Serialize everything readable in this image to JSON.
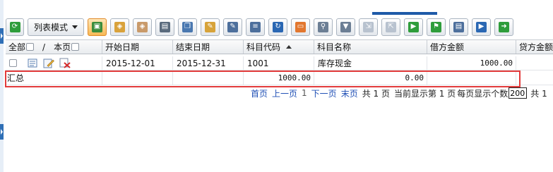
{
  "toolbar": {
    "view_mode_label": "列表模式",
    "buttons": [
      {
        "icon": "refresh-green-icon",
        "color": "#2e9d3b",
        "glyph": "⟳"
      },
      {
        "icon": "add-record-icon",
        "color": "#3c8d3c",
        "glyph": "▣",
        "active": true
      },
      {
        "icon": "archive-icon",
        "color": "#d9a23b",
        "glyph": "◈"
      },
      {
        "icon": "package-icon",
        "color": "#c99a6a",
        "glyph": "◈"
      },
      {
        "icon": "print-icon",
        "color": "#5a6b7d",
        "glyph": "▤"
      },
      {
        "icon": "copy-icon",
        "color": "#4a78b0",
        "glyph": "❐"
      },
      {
        "icon": "edit-icon",
        "color": "#d7a33a",
        "glyph": "✎"
      },
      {
        "icon": "document-edit-icon",
        "color": "#4d6f9c",
        "glyph": "✎"
      },
      {
        "icon": "document-list-icon",
        "color": "#4d6f9c",
        "glyph": "≡"
      },
      {
        "icon": "reload-icon",
        "color": "#2a67b3",
        "glyph": "↻"
      },
      {
        "icon": "window-icon",
        "color": "#e2772f",
        "glyph": "▭"
      },
      {
        "icon": "filter-clear-icon",
        "color": "#6c7f95",
        "glyph": "⚲"
      },
      {
        "icon": "filter-icon",
        "color": "#6c7f95",
        "glyph": "▼"
      },
      {
        "icon": "import-icon",
        "color": "#b8c2cf",
        "glyph": "⇲"
      },
      {
        "icon": "export-icon",
        "color": "#b8c2cf",
        "glyph": "⇱"
      },
      {
        "icon": "play-icon",
        "color": "#2e9d3b",
        "glyph": "▶"
      },
      {
        "icon": "bookmark-icon",
        "color": "#2e9d3b",
        "glyph": "⚑"
      },
      {
        "icon": "form-icon",
        "color": "#4d6f9c",
        "glyph": "▤"
      },
      {
        "icon": "next-circle-icon",
        "color": "#2a67b3",
        "glyph": "▶"
      },
      {
        "icon": "document-arrow-icon",
        "color": "#2e9d3b",
        "glyph": "➜"
      }
    ]
  },
  "table": {
    "header": {
      "select_all": "全部",
      "separator": "/",
      "this_page": "本页",
      "columns": [
        "开始日期",
        "结束日期",
        "科目代码",
        "科目名称",
        "借方金额",
        "贷方金额"
      ]
    },
    "rows": [
      {
        "start_date": "2015-12-01",
        "end_date": "2015-12-31",
        "account_code": "1001",
        "account_name": "库存现金",
        "debit": "1000.00",
        "credit": ""
      }
    ],
    "summary": {
      "label": "汇总",
      "debit_total": "1000.00",
      "credit_total": "0.00"
    }
  },
  "pager": {
    "first": "首页",
    "prev": "上一页",
    "current_page": "1",
    "next": "下一页",
    "last": "末页",
    "total_pages_text": "共 1 页",
    "current_display_text": "当前显示第 1 页",
    "per_page_label": "每页显示个数",
    "per_page_value": "200",
    "total_text": "共 1"
  },
  "colors": {
    "highlight": "#e23b3b",
    "link": "#1f4fb5",
    "accent": "#1e5aa8"
  }
}
